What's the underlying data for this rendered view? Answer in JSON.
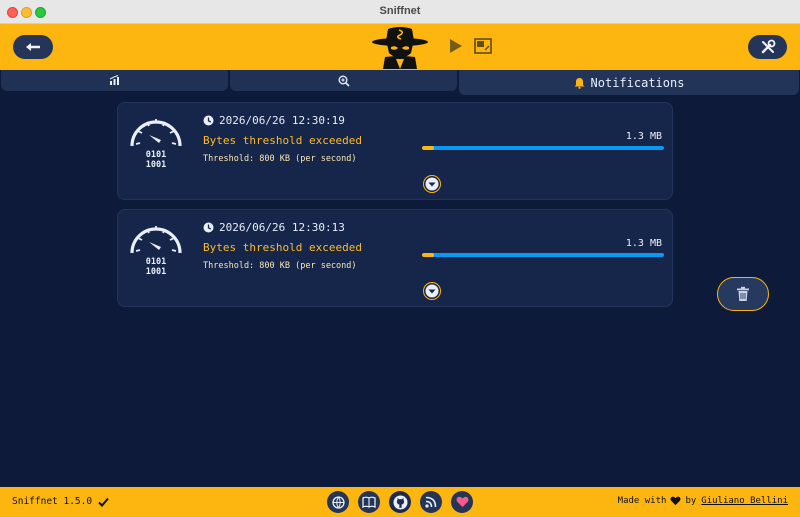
{
  "window": {
    "title": "Sniffnet"
  },
  "tabs": [
    {
      "icon": "chart-icon",
      "label": ""
    },
    {
      "icon": "inspect-icon",
      "label": ""
    },
    {
      "icon": "bell-icon",
      "label": "Notifications"
    }
  ],
  "notifications": [
    {
      "timestamp": "2026/06/26 12:30:19",
      "message": "Bytes threshold exceeded",
      "threshold": "Threshold: 800 KB (per second)",
      "value": "1.3 MB",
      "threshold_fraction": 0.05,
      "gauge_text": [
        "0101",
        "1001"
      ]
    },
    {
      "timestamp": "2026/06/26 12:30:13",
      "message": "Bytes threshold exceeded",
      "threshold": "Threshold: 800 KB (per second)",
      "value": "1.3 MB",
      "threshold_fraction": 0.05,
      "gauge_text": [
        "0101",
        "1001"
      ]
    }
  ],
  "footer": {
    "version": "Sniffnet 1.5.0",
    "made_with": "Made with",
    "by": "by",
    "author": "Giuliano Bellini"
  },
  "colors": {
    "accent": "#fdb60f",
    "background": "#0e1a3a",
    "card": "#16254a",
    "bar": "#0a98f0"
  }
}
